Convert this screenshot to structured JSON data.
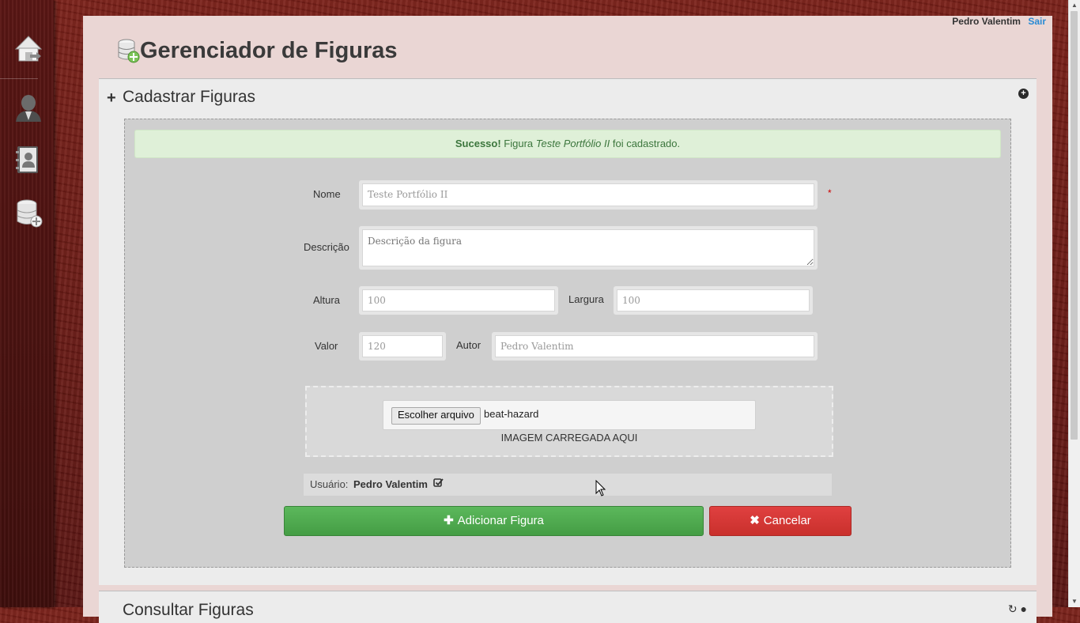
{
  "user": {
    "name": "Pedro Valentim",
    "logout_label": "Sair"
  },
  "header": {
    "title": "Gerenciador de Figuras",
    "icon": "database-add-icon"
  },
  "sidebar": {
    "items": [
      {
        "icon": "home-icon"
      },
      {
        "icon": "user-agent-icon"
      },
      {
        "icon": "contact-book-icon"
      },
      {
        "icon": "database-add-icon"
      }
    ]
  },
  "section": {
    "title": "Cadastrar Figuras",
    "next_title": "Consultar Figuras"
  },
  "alert": {
    "strong": "Sucesso!",
    "prefix": " Figura ",
    "figure": "Teste Portfólio II",
    "suffix": " foi cadastrado."
  },
  "form": {
    "nome_label": "Nome",
    "nome_value": "Teste Portfólio II",
    "descricao_label": "Descrição",
    "descricao_placeholder": "Descrição da figura",
    "altura_label": "Altura",
    "altura_value": "100",
    "largura_label": "Largura",
    "largura_value": "100",
    "valor_label": "Valor",
    "valor_value": "120",
    "autor_label": "Autor",
    "autor_value": "Pedro Valentim",
    "required_mark": "*"
  },
  "upload": {
    "button_label": "Escolher arquivo",
    "file_name": "beat-hazard",
    "caption": "IMAGEM CARREGADA AQUI"
  },
  "user_row": {
    "label": "Usuário:",
    "value": "Pedro Valentim"
  },
  "actions": {
    "add_label": "Adicionar Figura",
    "cancel_label": "Cancelar"
  },
  "colors": {
    "success": "#5cb85c",
    "danger": "#d9534f",
    "link": "#2a8bd4",
    "alert_bg": "#dff0d8"
  }
}
